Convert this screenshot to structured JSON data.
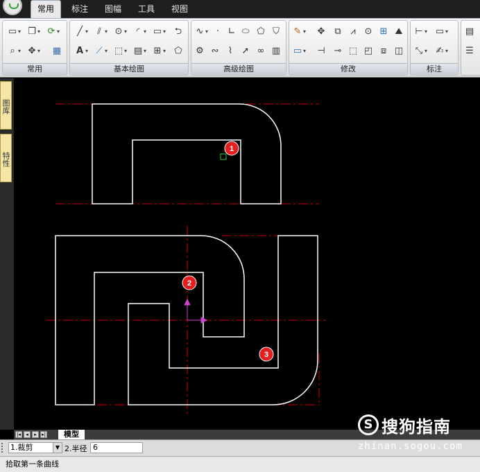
{
  "tabs": [
    {
      "label": "常用",
      "active": true
    },
    {
      "label": "标注",
      "active": false
    },
    {
      "label": "图幅",
      "active": false
    },
    {
      "label": "工具",
      "active": false
    },
    {
      "label": "视图",
      "active": false
    }
  ],
  "ribbon": {
    "groups": [
      "常用",
      "基本绘图",
      "高级绘图",
      "修改",
      "标注"
    ]
  },
  "left_panel": {
    "tab1": "图库",
    "tab2": "特性"
  },
  "markers": {
    "m1": "1",
    "m2": "2",
    "m3": "3"
  },
  "model_tab": "模型",
  "command": {
    "option1_prefix": "1.",
    "option1_value": "裁剪",
    "option2_label": "2.半径",
    "option2_value": "6"
  },
  "status_text": "拾取第一条曲线",
  "watermark": {
    "brand": "搜狗指南",
    "url": "zhinan.sogou.com",
    "icon_letter": "S"
  },
  "colors": {
    "canvas": "#000000",
    "geometry": "#ffffff",
    "centerline": "#cc0000",
    "marker": "#e02020",
    "ucs": "#cc44cc",
    "pick": "#33cc33"
  }
}
